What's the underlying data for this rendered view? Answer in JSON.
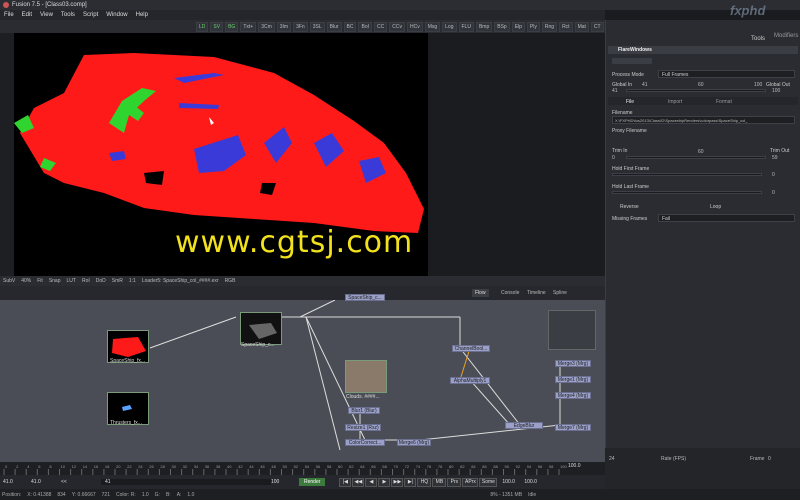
{
  "window": {
    "title": "Fusion 7.5 - [Class03.comp]"
  },
  "menu": [
    "File",
    "Edit",
    "View",
    "Tools",
    "Script",
    "Window",
    "Help"
  ],
  "toolbar": [
    "LD",
    "SV",
    "BG",
    "Txt+",
    "3Cm",
    "3Im",
    "3Fn",
    "3SL",
    "Blur",
    "BC",
    "BoI",
    "CC",
    "CCv",
    "HCv",
    "Msg",
    "Log",
    "FLU",
    "Bmp",
    "BSp",
    "Elp",
    "Ply",
    "Rng",
    "Rct",
    "Mat",
    "CT",
    "pEm",
    "pRn",
    "Rsz",
    "Xf"
  ],
  "viewer_bar": {
    "sub": "SubV",
    "zoom": "40%",
    "fit": "Fit",
    "snap": "Snap",
    "lut": "LUT",
    "roi": "RoI",
    "dod": "DoD",
    "smr": "SmR",
    "ratio": "1:1",
    "loader": "Loader5: SpaceShip_col_####.exr",
    "rgb": "RGB"
  },
  "flow": {
    "tabs": [
      "Flow",
      "Console",
      "Timeline",
      "Spline"
    ],
    "nodes": {
      "spaceship_col": "SpaceShip_c...",
      "spaceship_top": "SpaceShip_c...",
      "spaceship_left": "SpaceShip_fx...",
      "thrusters": "Thrusters_fx...",
      "clouds": "Clouds. ####...",
      "channelbool": "ChannelBool...",
      "alphamultiply": "AlphaMultiply1",
      "blur1": "Blur1 (Blur)",
      "resize": "Resize1 (Rsz)",
      "colorcorrect": "ColorCorrect...",
      "merge6": "Merge6 (Mrg)",
      "edgeblur": "EdgeBlur",
      "merge3": "Merge3 (Mrg)",
      "merge1": "Merge1 (Mrg)",
      "merge4": "Merge4 (Mrg)",
      "merge7": "Merge7 (Mrg)"
    }
  },
  "timeline": {
    "ticks": [
      "0",
      "2",
      "4",
      "6",
      "8",
      "10",
      "12",
      "14",
      "16",
      "18",
      "20",
      "22",
      "24",
      "26",
      "28",
      "30",
      "32",
      "34",
      "36",
      "38",
      "40",
      "42",
      "44",
      "46",
      "48",
      "50",
      "52",
      "54",
      "56",
      "58",
      "60",
      "62",
      "64",
      "66",
      "68",
      "70",
      "72",
      "74",
      "76",
      "78",
      "80",
      "82",
      "84",
      "86",
      "88",
      "90",
      "92",
      "94",
      "96",
      "98",
      "100"
    ],
    "end": "100.0"
  },
  "transport": {
    "start": "41.0",
    "current": "41.0",
    "mark1": "<<",
    "frame": "41",
    "end_render": "100",
    "render_label": "Render",
    "hq": "HQ",
    "mb": "MB",
    "prx": "Prx",
    "aprx": "APrx",
    "some": "Some",
    "end1": "100.0",
    "end2": "100.0"
  },
  "status": {
    "position": "Position:",
    "x": "X: 0.41388",
    "x2": "834",
    "y": "Y: 0.66667",
    "y2": "721",
    "color": "Color: R:",
    "r": "1.0",
    "g": "G:",
    "b": "B:",
    "a": "A:",
    "a_val": "1.0",
    "mem": "8% - 1351 MB",
    "state": "Idle"
  },
  "right_panel": {
    "tabs": [
      "Tools",
      "Modifiers"
    ],
    "tool_name": "FlareWindows",
    "process_mode_label": "Process Mode",
    "process_mode": "Full Frames",
    "global_in_label": "Global In",
    "global_in": "41",
    "global_out_label": "Global Out",
    "global_out": "100",
    "slider_ticks": [
      "41",
      "60",
      "100"
    ],
    "subtabs": [
      "File",
      "Import",
      "Format"
    ],
    "filename_label": "Filename",
    "filename": "X:\\FXPHD\\fus2013\\Class02\\SpaceshipRenders\\colorpass\\SpaceShip_col_",
    "proxy_label": "Proxy Filename",
    "trim_in_label": "Trim In",
    "trim_in": "0",
    "trim_mid": "60",
    "trim_out_label": "Trim Out",
    "trim_out": "59",
    "hold_first_label": "Hold First Frame",
    "hold_first": "0",
    "hold_last_label": "Hold Last Frame",
    "hold_last": "0",
    "reverse": "Reverse",
    "loop": "Loop",
    "missing_label": "Missing Frames",
    "missing": "Fail",
    "rate_value": "24",
    "rate_label": "Rate (FPS)",
    "frame_label": "Frame",
    "frame_value": "0"
  },
  "watermark": "www.cgtsj.com",
  "logo": "fxphd",
  "colors": {
    "red": "#ff1a1a",
    "green": "#2fd42f",
    "blue": "#3a3ad8",
    "accent": "#e8a020"
  }
}
